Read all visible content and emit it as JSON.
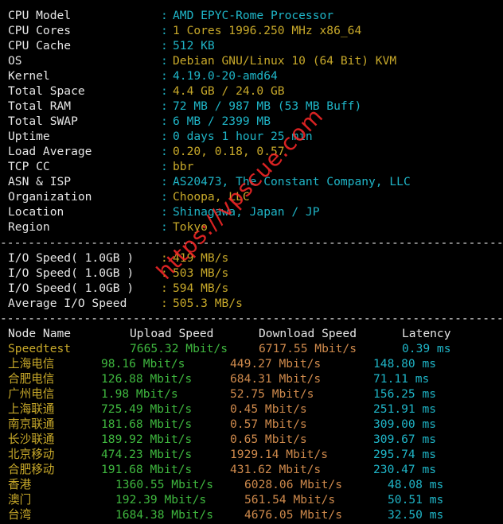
{
  "system_info": [
    {
      "label": "CPU Model",
      "value": "AMD EPYC-Rome Processor",
      "color": "cyan"
    },
    {
      "label": "CPU Cores",
      "value": "1 Cores 1996.250 MHz x86_64",
      "color": "yellow"
    },
    {
      "label": "CPU Cache",
      "value": "512 KB",
      "color": "cyan"
    },
    {
      "label": "OS",
      "value": "Debian GNU/Linux 10 (64 Bit) KVM",
      "color": "yellow"
    },
    {
      "label": "Kernel",
      "value": "4.19.0-20-amd64",
      "color": "cyan"
    },
    {
      "label": "Total Space",
      "value": "4.4 GB / 24.0 GB",
      "color": "yellow"
    },
    {
      "label": "Total RAM",
      "value": "72 MB / 987 MB (53 MB Buff)",
      "color": "cyan"
    },
    {
      "label": "Total SWAP",
      "value": "6 MB / 2399 MB",
      "color": "cyan"
    },
    {
      "label": "Uptime",
      "value": "0 days 1 hour 25 min",
      "color": "cyan"
    },
    {
      "label": "Load Average",
      "value": "0.20, 0.18, 0.57",
      "color": "yellow"
    },
    {
      "label": "TCP CC",
      "value": "bbr",
      "color": "yellow"
    },
    {
      "label": "ASN & ISP",
      "value": "AS20473, The Constant Company, LLC",
      "color": "cyan"
    },
    {
      "label": "Organization",
      "value": "Choopa, LLC",
      "color": "yellow"
    },
    {
      "label": "Location",
      "value": "Shinagawa, Japan / JP",
      "color": "cyan"
    },
    {
      "label": "Region",
      "value": "Tokyo",
      "color": "yellow"
    }
  ],
  "separator_char": "-",
  "colon": ":",
  "io_speed": [
    {
      "label": "I/O Speed( 1.0GB )",
      "value": "419 MB/s"
    },
    {
      "label": "I/O Speed( 1.0GB )",
      "value": "503 MB/s"
    },
    {
      "label": "I/O Speed( 1.0GB )",
      "value": "594 MB/s"
    },
    {
      "label": "Average I/O Speed",
      "value": "505.3 MB/s"
    }
  ],
  "speed_table": {
    "headers": {
      "node": "Node Name",
      "upload": "Upload Speed",
      "download": "Download Speed",
      "latency": "Latency"
    },
    "rows": [
      {
        "node": "Speedtest",
        "upload": "7665.32 Mbit/s",
        "download": "6717.55 Mbit/s",
        "latency": "0.39 ms",
        "group": "a"
      },
      {
        "node": "上海电信",
        "upload": "98.16 Mbit/s",
        "download": "449.27 Mbit/s",
        "latency": "148.80 ms",
        "group": "b"
      },
      {
        "node": "合肥电信",
        "upload": "126.88 Mbit/s",
        "download": "684.31 Mbit/s",
        "latency": "71.11 ms",
        "group": "b"
      },
      {
        "node": "广州电信",
        "upload": "1.98 Mbit/s",
        "download": "52.75 Mbit/s",
        "latency": "156.25 ms",
        "group": "b"
      },
      {
        "node": "上海联通",
        "upload": "725.49 Mbit/s",
        "download": "0.45 Mbit/s",
        "latency": "251.91 ms",
        "group": "b"
      },
      {
        "node": "南京联通",
        "upload": "181.68 Mbit/s",
        "download": "0.57 Mbit/s",
        "latency": "309.00 ms",
        "group": "b"
      },
      {
        "node": "长沙联通",
        "upload": "189.92 Mbit/s",
        "download": "0.65 Mbit/s",
        "latency": "309.67 ms",
        "group": "b"
      },
      {
        "node": "北京移动",
        "upload": "474.23 Mbit/s",
        "download": "1929.14 Mbit/s",
        "latency": "295.74 ms",
        "group": "b"
      },
      {
        "node": "合肥移动",
        "upload": "191.68 Mbit/s",
        "download": "431.62 Mbit/s",
        "latency": "230.47 ms",
        "group": "b"
      },
      {
        "node": "香港",
        "upload": "1360.55 Mbit/s",
        "download": "6028.06 Mbit/s",
        "latency": "48.08 ms",
        "group": "c"
      },
      {
        "node": "澳门",
        "upload": "192.39 Mbit/s",
        "download": "561.54 Mbit/s",
        "latency": "50.51 ms",
        "group": "c"
      },
      {
        "node": "台湾",
        "upload": "1684.38 Mbit/s",
        "download": "4676.05 Mbit/s",
        "latency": "32.50 ms",
        "group": "c"
      }
    ]
  },
  "watermark": "https://vpscue.com",
  "colors": {
    "cyan": "#1fb5c7",
    "yellow": "#c8a92a",
    "green": "#3fb83f",
    "orange": "#cf8a4c",
    "text": "#e6e6e6",
    "background": "#000000"
  }
}
